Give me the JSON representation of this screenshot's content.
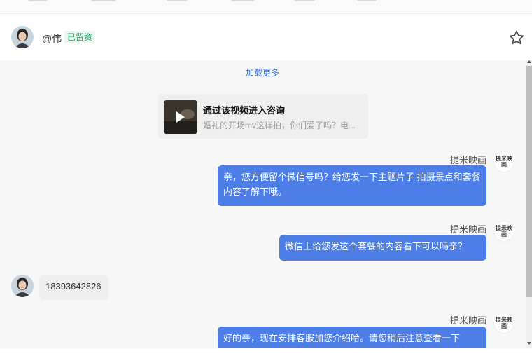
{
  "header": {
    "contact_name": "@伟",
    "badge": "已留资",
    "star_icon": "star-outline-icon"
  },
  "chat": {
    "load_more": "加载更多",
    "video_card": {
      "title": "通过该视频进入咨询",
      "subtitle": "婚礼的开场mv这样拍，你们爱了吗？电...",
      "icon": "play-icon"
    },
    "messages": [
      {
        "direction": "out",
        "sender": "提米映画",
        "avatar_text": "提米映画",
        "text": "亲，您方便留个微信号吗？给您发一下主题片子 拍摄景点和套餐内容了解下哦。"
      },
      {
        "direction": "out",
        "sender": "提米映画",
        "avatar_text": "提米映画",
        "text": "微信上给您发这个套餐的内容看下可以吗亲？"
      },
      {
        "direction": "in",
        "text": "18393642826"
      },
      {
        "direction": "out",
        "sender": "提米映画",
        "avatar_text": "提米映画",
        "text": "好的亲，现在安排客服加您介绍哈。请您稍后注意查看一下"
      }
    ]
  },
  "colors": {
    "outgoing_bubble": "#4d7ee8",
    "incoming_bubble": "#eeeeee",
    "badge_text": "#1aa35a",
    "link": "#3a6fd8"
  }
}
